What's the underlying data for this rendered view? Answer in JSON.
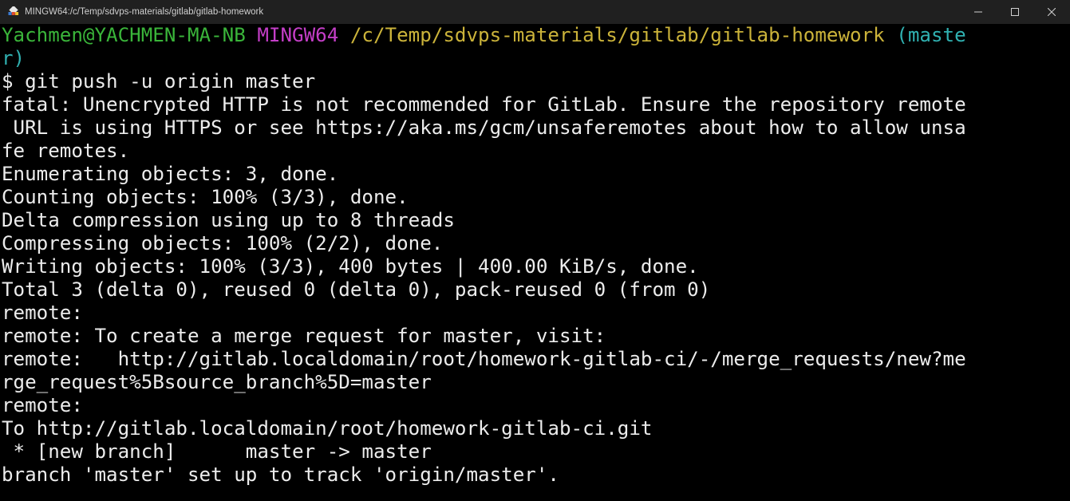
{
  "window": {
    "title": "MINGW64:/c/Temp/sdvps-materials/gitlab/gitlab-homework",
    "controls": {
      "minimize_icon": "minimize-icon",
      "maximize_icon": "maximize-icon",
      "close_icon": "close-icon"
    }
  },
  "colors": {
    "user_host": "#3ab53a",
    "shell": "#c43ec7",
    "path": "#cbb33a",
    "branch": "#30b1b1",
    "text": "#ececec",
    "background": "#000000"
  },
  "prompt": {
    "user_host": "Yachmen@YACHMEN-MA-NB",
    "shell": "MINGW64",
    "path": "/c/Temp/sdvps-materials/gitlab/gitlab-homework",
    "branch_line1": "(maste",
    "branch_line2": "r)"
  },
  "command": "$ git push -u origin master",
  "output": [
    "fatal: Unencrypted HTTP is not recommended for GitLab. Ensure the repository remote",
    " URL is using HTTPS or see https://aka.ms/gcm/unsaferemotes about how to allow unsa",
    "fe remotes.",
    "Enumerating objects: 3, done.",
    "Counting objects: 100% (3/3), done.",
    "Delta compression using up to 8 threads",
    "Compressing objects: 100% (2/2), done.",
    "Writing objects: 100% (3/3), 400 bytes | 400.00 KiB/s, done.",
    "Total 3 (delta 0), reused 0 (delta 0), pack-reused 0 (from 0)",
    "remote:",
    "remote: To create a merge request for master, visit:",
    "remote:   http://gitlab.localdomain/root/homework-gitlab-ci/-/merge_requests/new?me",
    "rge_request%5Bsource_branch%5D=master",
    "remote:",
    "To http://gitlab.localdomain/root/homework-gitlab-ci.git",
    " * [new branch]      master -> master",
    "branch 'master' set up to track 'origin/master'."
  ]
}
